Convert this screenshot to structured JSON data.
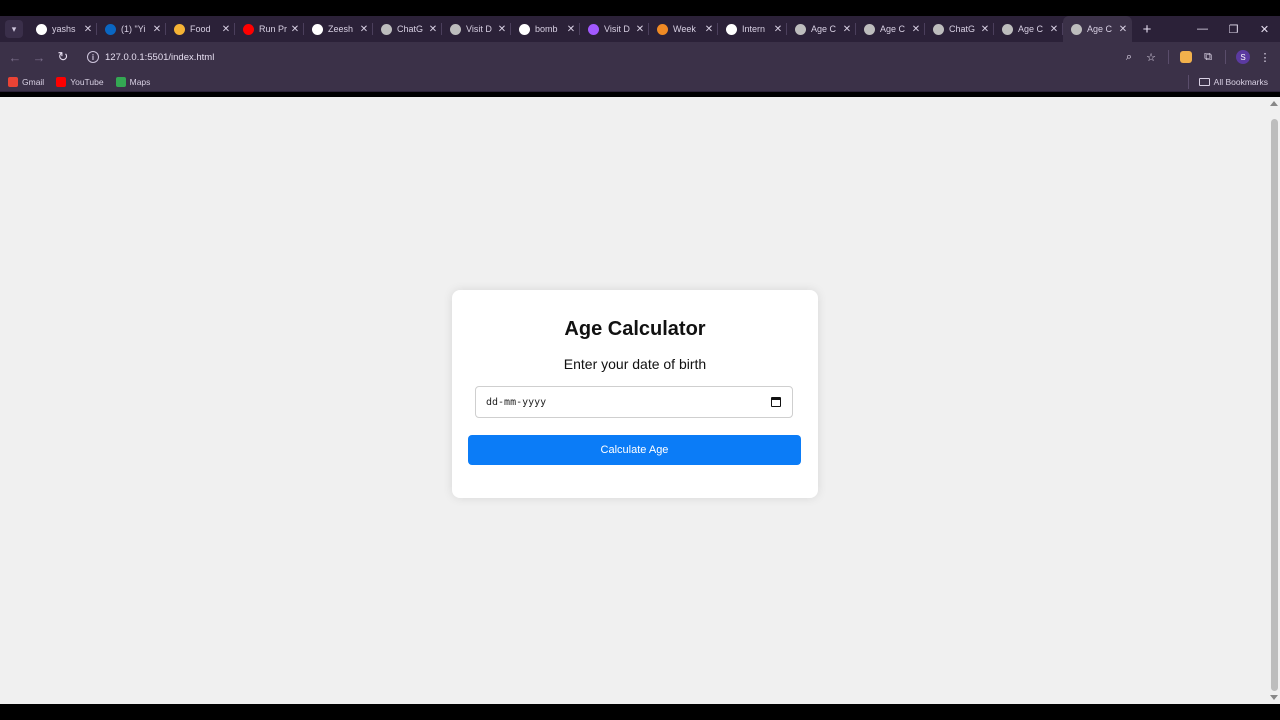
{
  "browser": {
    "tabs": [
      {
        "title": "yashs",
        "icon": "github-icon",
        "color": "#ffffff"
      },
      {
        "title": "(1) \"Yi",
        "icon": "linkedin-icon",
        "color": "#0a66c2"
      },
      {
        "title": "Food",
        "icon": "food-site-icon",
        "color": "#f5b335"
      },
      {
        "title": "Run Pr",
        "icon": "youtube-icon",
        "color": "#ff0000"
      },
      {
        "title": "Zeesh",
        "icon": "github-icon",
        "color": "#ffffff"
      },
      {
        "title": "ChatG",
        "icon": "chatgpt-icon",
        "color": "#bdbdbd"
      },
      {
        "title": "Visit D",
        "icon": "globe-icon",
        "color": "#bdbdbd"
      },
      {
        "title": "bomb",
        "icon": "google-icon",
        "color": "#ffffff"
      },
      {
        "title": "Visit D",
        "icon": "figma-icon",
        "color": "#a259ff"
      },
      {
        "title": "Week",
        "icon": "orange-site-icon",
        "color": "#f08a24"
      },
      {
        "title": "Intern",
        "icon": "a-site-icon",
        "color": "#ffffff"
      },
      {
        "title": "Age C",
        "icon": "globe-icon",
        "color": "#bdbdbd"
      },
      {
        "title": "Age C",
        "icon": "globe-icon",
        "color": "#bdbdbd"
      },
      {
        "title": "ChatG",
        "icon": "chatgpt-icon",
        "color": "#bdbdbd"
      },
      {
        "title": "Age C",
        "icon": "globe-icon",
        "color": "#bdbdbd"
      },
      {
        "title": "Age C",
        "icon": "globe-icon",
        "color": "#bdbdbd",
        "active": true
      }
    ],
    "url": "127.0.0.1:5501/index.html",
    "profile_initial": "S",
    "bookmarks": [
      {
        "label": "Gmail",
        "icon": "gmail-icon",
        "color": "#ea4335"
      },
      {
        "label": "YouTube",
        "icon": "youtube-icon",
        "color": "#ff0000"
      },
      {
        "label": "Maps",
        "icon": "maps-icon",
        "color": "#34a853"
      }
    ],
    "all_bookmarks_label": "All Bookmarks"
  },
  "page": {
    "title": "Age Calculator",
    "subtitle": "Enter your date of birth",
    "date_placeholder": "dd-mm-yyyy",
    "button_label": "Calculate Age",
    "accent_color": "#0b7cf7"
  }
}
